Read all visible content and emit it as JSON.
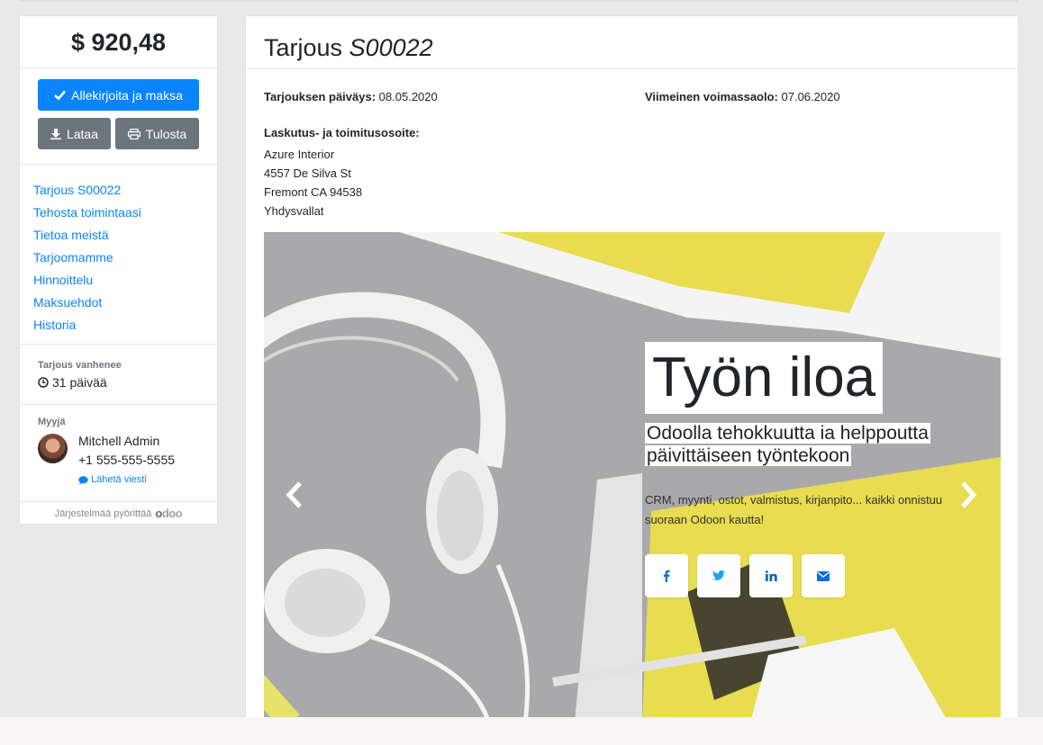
{
  "summary": {
    "amount": "$ 920,48",
    "sign_pay_label": "Allekirjoita ja maksa",
    "download_label": "Lataa",
    "print_label": "Tulosta"
  },
  "nav": {
    "items": [
      {
        "label": "Tarjous S00022"
      },
      {
        "label": "Tehosta toimintaasi"
      },
      {
        "label": "Tietoa meistä"
      },
      {
        "label": "Tarjoomamme"
      },
      {
        "label": "Hinnoittelu"
      },
      {
        "label": "Maksuehdot"
      },
      {
        "label": "Historia"
      }
    ]
  },
  "expiry": {
    "label": "Tarjous vanhenee",
    "value": "31 päivää"
  },
  "seller": {
    "label": "Myyjä",
    "name": "Mitchell Admin",
    "phone": "+1 555-555-5555",
    "message_label": "Lähetä viesti"
  },
  "footer": {
    "powered_by": "Järjestelmää pyörittää"
  },
  "quote": {
    "title_prefix": "Tarjous",
    "number": "S00022",
    "date_label": "Tarjouksen päiväys:",
    "date_value": "08.05.2020",
    "expiry_label": "Viimeinen voimassaolo:",
    "expiry_value": "07.06.2020",
    "address_label": "Laskutus- ja toimitusosoite:",
    "address_lines": [
      "Azure Interior",
      "4557 De Silva St",
      "Fremont CA 94538",
      "Yhdysvallat"
    ]
  },
  "hero": {
    "title": "Työn iloa",
    "subtitle": "Odoolla tehokkuutta ia helppoutta päivittäiseen työntekoon",
    "text": "CRM, myynti, ostot, valmistus, kirjanpito... kaikki onnistuu suoraan Odoon kautta!",
    "social_icons": [
      "facebook-icon",
      "twitter-icon",
      "linkedin-icon",
      "email-icon"
    ]
  },
  "colors": {
    "primary": "#0a84ff",
    "secondary": "#6c757d",
    "odoo_brand": "#875a7b"
  }
}
